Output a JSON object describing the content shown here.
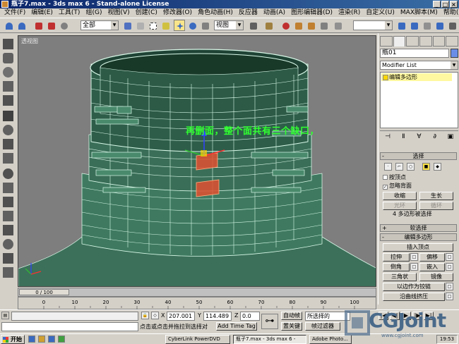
{
  "window": {
    "title": "瓶子7.max - 3ds max 6 - Stand-alone License"
  },
  "menu": [
    "文件(F)",
    "编辑(E)",
    "工具(T)",
    "组(G)",
    "视图(V)",
    "创建(C)",
    "修改器(O)",
    "角色动画(H)",
    "反应器",
    "动画(A)",
    "图形编辑器(D)",
    "渲染(R)",
    "自定义(U)",
    "MAX脚本(M)",
    "帮助(H)"
  ],
  "toolbar": {
    "selection_filter": "全部",
    "reference_coord": "视图"
  },
  "viewport": {
    "label": "透视图",
    "annotation": "再删面，整个面共有三个缺口，",
    "annotation_color": "#30ff30",
    "wire_color": "#d8f8e8",
    "mesh_color": "#2a5c48",
    "selection_color": "#e05030"
  },
  "command_panel": {
    "object_name": "瓶01",
    "object_color": "#6a8ee8",
    "modifier_list": "Modifier List",
    "stack_item": "编辑多边形",
    "rollouts": {
      "selection": "选择",
      "by_vertex": "按顶点",
      "ignore_backfacing": "忽略背面",
      "shrink": "收缩",
      "grow": "生长",
      "ring": "光环",
      "loop": "循环",
      "selected_count": "4 多边形被选择",
      "soft_selection": "软选择",
      "edit_polygons": "编辑多边形"
    },
    "edit_buttons": {
      "insert_vertex": "插入顶点",
      "extrude": "拉伸",
      "offset": "偏移",
      "bevel": "倒角",
      "inset": "嵌入",
      "triangulate": "三角状",
      "mirror": "镜像",
      "hinge": "以边作为铰链",
      "extrude_along_spline": "沿曲线挤压"
    }
  },
  "timeline": {
    "slider": "0 / 100",
    "ticks": [
      "0",
      "10",
      "20",
      "30",
      "40",
      "50",
      "60",
      "70",
      "80",
      "90",
      "100"
    ]
  },
  "status": {
    "x_label": "X",
    "x_value": "207.001",
    "y_label": "Y",
    "y_value": "114.489",
    "z_label": "Z",
    "z_value": "0.0",
    "prompt": "点击或点击并拖拉到选择对",
    "add_time_tag": "Add Time Tag",
    "auto_key": "自动帧",
    "set_key": "置关键",
    "key_filter_value": "所选择的",
    "key_filters": "帧过滤器"
  },
  "taskbar": {
    "start": "开始",
    "tasks": [
      "CyberLink PowerDVD",
      "瓶子7.max - 3ds max 6 -",
      "Adobe Photo..."
    ],
    "clock": "19:53"
  },
  "watermark": {
    "brand": "CGJoint",
    "url": "www.cgjoint.com"
  }
}
